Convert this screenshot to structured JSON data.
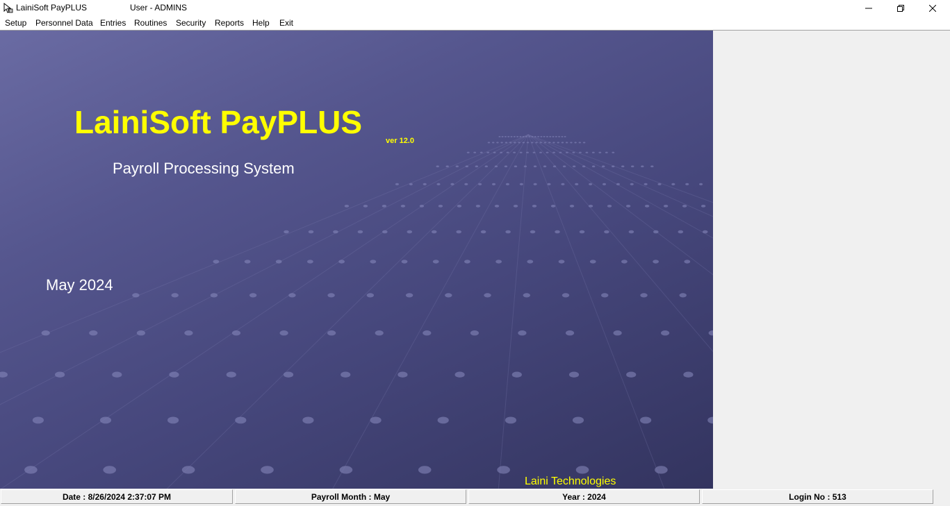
{
  "window": {
    "app_title": "LainiSoft PayPLUS",
    "user_label": "User -  ADMINS"
  },
  "menu": [
    {
      "label": "Setup"
    },
    {
      "label": "Personnel Data"
    },
    {
      "label": "Entries"
    },
    {
      "label": "Routines"
    },
    {
      "label": "Security"
    },
    {
      "label": "Reports"
    },
    {
      "label": "Help"
    },
    {
      "label": "Exit"
    }
  ],
  "splash": {
    "title": "LainiSoft PayPLUS",
    "version": "ver 12.0",
    "subtitle": "Payroll Processing System",
    "period": "May 2024",
    "company": "Laini Technologies"
  },
  "status": {
    "date": "Date : 8/26/2024 2:37:07 PM",
    "payroll_month": "Payroll Month : May",
    "year": "Year : 2024",
    "login": "Login No : 513"
  },
  "colors": {
    "accent_yellow": "#ffff00",
    "splash_bg": "#4f5088"
  },
  "icons": {
    "app": "app-icon",
    "minimize": "minimize-icon",
    "maximize": "restore-icon",
    "close": "close-icon"
  }
}
